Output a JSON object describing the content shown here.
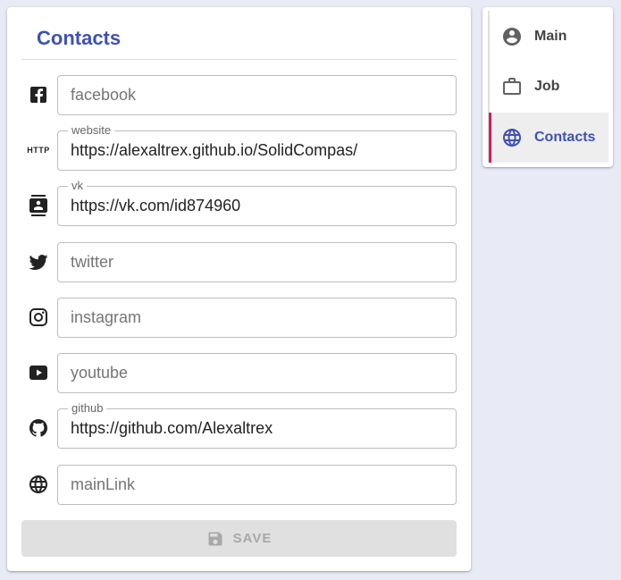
{
  "card": {
    "title": "Contacts"
  },
  "fields": {
    "facebook": {
      "placeholder": "facebook",
      "label": "",
      "value": ""
    },
    "website": {
      "placeholder": "website",
      "label": "website",
      "value": "https://alexaltrex.github.io/SolidCompas/"
    },
    "vk": {
      "placeholder": "vk",
      "label": "vk",
      "value": "https://vk.com/id874960"
    },
    "twitter": {
      "placeholder": "twitter",
      "label": "",
      "value": ""
    },
    "instagram": {
      "placeholder": "instagram",
      "label": "",
      "value": ""
    },
    "youtube": {
      "placeholder": "youtube",
      "label": "",
      "value": ""
    },
    "github": {
      "placeholder": "github",
      "label": "github",
      "value": "https://github.com/Alexaltrex"
    },
    "mainLink": {
      "placeholder": "mainLink",
      "label": "",
      "value": ""
    }
  },
  "icons": {
    "http_text": "HTTP"
  },
  "save": {
    "label": "SAVE"
  },
  "side_nav": {
    "items": [
      {
        "label": "Main",
        "icon": "account-circle-icon"
      },
      {
        "label": "Job",
        "icon": "briefcase-icon"
      },
      {
        "label": "Contacts",
        "icon": "globe-icon",
        "active": true
      }
    ]
  },
  "colors": {
    "accent": "#3f51b5",
    "active_indicator": "#d81b60",
    "background": "#e8eaf6"
  }
}
